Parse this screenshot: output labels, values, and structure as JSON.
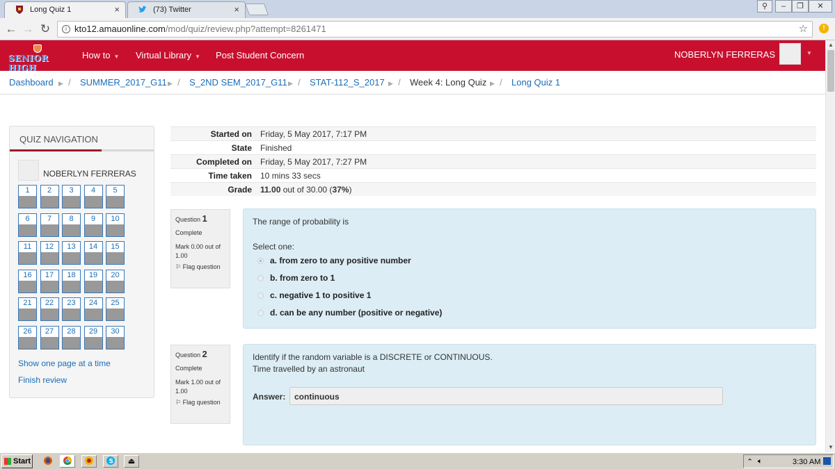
{
  "browser": {
    "tabs": [
      {
        "title": "Long Quiz 1",
        "icon": "moodle-shield-icon",
        "active": true
      },
      {
        "title": "(73) Twitter",
        "icon": "twitter-bird-icon",
        "active": false
      }
    ],
    "url_host": "kto12.amauonline.com",
    "url_path": "/mod/quiz/review.php?attempt=8261471"
  },
  "navbar": {
    "logo_text": "SENIOR HIGH",
    "items": [
      {
        "label": "How to",
        "dropdown": true
      },
      {
        "label": "Virtual Library",
        "dropdown": true
      },
      {
        "label": "Post Student Concern",
        "dropdown": false
      }
    ],
    "user_name": "NOBERLYN FERRERAS",
    "bg_color": "#c8102e"
  },
  "breadcrumb": [
    "Dashboard",
    "SUMMER_2017_G11",
    "S_2ND SEM_2017_G11",
    "STAT-112_S_2017",
    "Week 4: Long Quiz",
    "Long Quiz 1"
  ],
  "quiz_nav": {
    "title": "QUIZ NAVIGATION",
    "user_name": "NOBERLYN FERRERAS",
    "questions": [
      "1",
      "2",
      "3",
      "4",
      "5",
      "6",
      "7",
      "8",
      "9",
      "10",
      "11",
      "12",
      "13",
      "14",
      "15",
      "16",
      "17",
      "18",
      "19",
      "20",
      "21",
      "22",
      "23",
      "24",
      "25",
      "26",
      "27",
      "28",
      "29",
      "30"
    ],
    "links": [
      "Show one page at a time",
      "Finish review"
    ]
  },
  "summary": [
    {
      "label": "Started on",
      "value": "Friday, 5 May 2017, 7:17 PM"
    },
    {
      "label": "State",
      "value": "Finished"
    },
    {
      "label": "Completed on",
      "value": "Friday, 5 May 2017, 7:27 PM"
    },
    {
      "label": "Time taken",
      "value": "10 mins 33 secs"
    },
    {
      "label": "Grade",
      "value_bold": "11.00",
      "value_mid": " out of 30.00 (",
      "value_pct": "37%",
      "value_end": ")"
    }
  ],
  "questions": [
    {
      "label": "Question",
      "number": "1",
      "state": "Complete",
      "mark": "Mark 0.00 out of 1.00",
      "flag": "Flag question",
      "text": "The range of probability is",
      "prompt": "Select one:",
      "options": [
        "a. from zero to any positive number",
        "b. from zero to 1",
        "c. negative 1 to positive 1",
        "d. can be any number (positive or negative)"
      ],
      "selected_index": 0
    },
    {
      "label": "Question",
      "number": "2",
      "state": "Complete",
      "mark": "Mark 1.00 out of 1.00",
      "flag": "Flag question",
      "text_line1": "Identify if the random variable is a DISCRETE or CONTINUOUS.",
      "text_line2": "Time travelled by an astronaut",
      "answer_label": "Answer:",
      "answer_value": "continuous"
    }
  ],
  "taskbar": {
    "start_label": "Start",
    "clock": "3:30 AM",
    "apps": [
      "firefox-icon",
      "chrome-icon",
      "browser-icon",
      "skype-icon",
      "usb-icon"
    ]
  }
}
